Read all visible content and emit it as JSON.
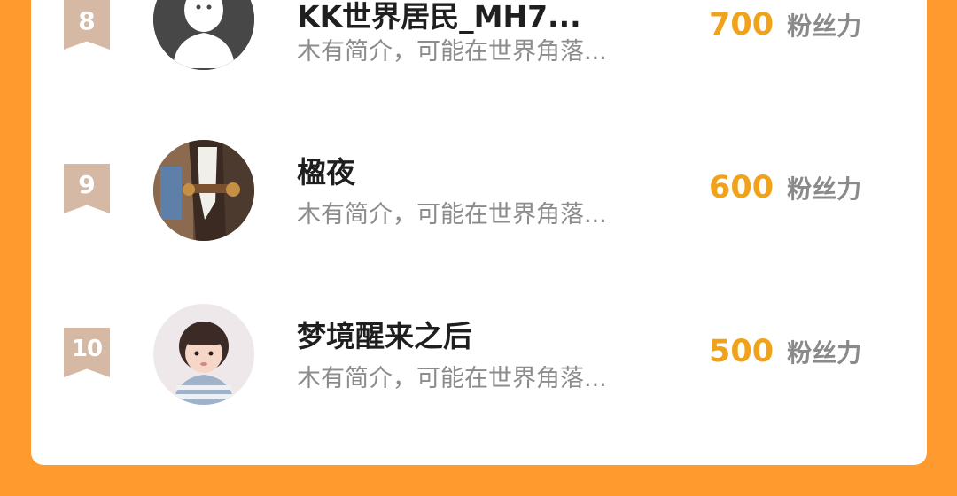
{
  "ranking": {
    "items": [
      {
        "rank": "8",
        "name": "KK世界居民_MH7...",
        "bio": "木有简介，可能在世界角落...",
        "score": "700",
        "unit": "粉丝力",
        "avatar": "default-avatar"
      },
      {
        "rank": "9",
        "name": "楹夜",
        "bio": "木有简介，可能在世界角落...",
        "score": "600",
        "unit": "粉丝力",
        "avatar": "horse-photo"
      },
      {
        "rank": "10",
        "name": "梦境醒来之后",
        "bio": "木有简介，可能在世界角落...",
        "score": "500",
        "unit": "粉丝力",
        "avatar": "child-photo"
      }
    ]
  },
  "colors": {
    "background": "#FF9A2E",
    "badge": "#D5B9A4",
    "score": "#F0A21B"
  }
}
